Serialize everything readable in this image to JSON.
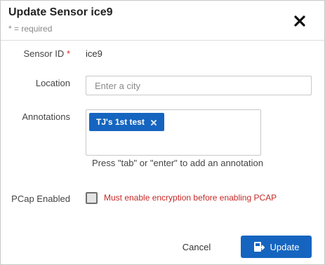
{
  "dialog": {
    "title": "Update Sensor ice9",
    "subtitle": "* = required",
    "close_icon": "close-icon"
  },
  "form": {
    "sensor_id": {
      "label": "Sensor ID",
      "required_marker": "*",
      "value": "ice9"
    },
    "location": {
      "label": "Location",
      "value": "",
      "placeholder": "Enter a city"
    },
    "annotations": {
      "label": "Annotations",
      "tags": [
        {
          "text": "TJ's 1st test",
          "remove_icon": "close-icon"
        }
      ],
      "helper": "Press \"tab\" or \"enter\" to add an annotation"
    },
    "pcap": {
      "label": "PCap Enabled",
      "checked": false,
      "warning": "Must enable encryption before enabling PCAP"
    }
  },
  "footer": {
    "cancel_label": "Cancel",
    "update_label": "Update",
    "update_icon": "update-icon"
  },
  "colors": {
    "primary": "#1565c0",
    "required": "#d32f2f",
    "warning": "#c62828"
  }
}
